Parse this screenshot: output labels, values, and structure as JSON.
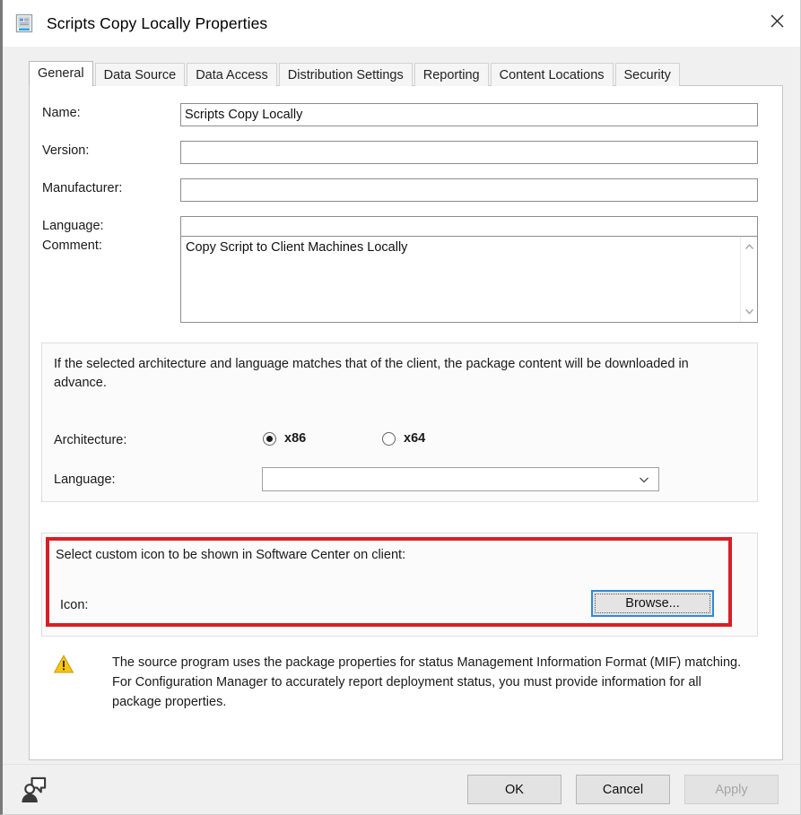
{
  "window": {
    "title": "Scripts Copy Locally Properties",
    "title_icon": "properties-document-icon",
    "close_label": "✕"
  },
  "tabs": [
    {
      "label": "General",
      "active": true
    },
    {
      "label": "Data Source",
      "active": false
    },
    {
      "label": "Data Access",
      "active": false
    },
    {
      "label": "Distribution Settings",
      "active": false
    },
    {
      "label": "Reporting",
      "active": false
    },
    {
      "label": "Content Locations",
      "active": false
    },
    {
      "label": "Security",
      "active": false
    }
  ],
  "general": {
    "fields": [
      {
        "label": "Name:",
        "value": "Scripts Copy Locally",
        "placeholder": ""
      },
      {
        "label": "Version:",
        "value": "",
        "placeholder": ""
      },
      {
        "label": "Manufacturer:",
        "value": "",
        "placeholder": ""
      },
      {
        "label": "Language:",
        "value": "",
        "placeholder": ""
      }
    ],
    "comment": {
      "label": "Comment:",
      "value": "Copy Script to Client Machines Locally",
      "placeholder": "",
      "scroll_up_icon": "chevron-up-icon",
      "scroll_down_icon": "chevron-down-icon"
    },
    "architecture_group": {
      "description": "If the selected architecture and language matches that of the client, the package content will be downloaded in advance.",
      "architecture_label": "Architecture:",
      "options": [
        {
          "label": "x86",
          "selected": true
        },
        {
          "label": "x64",
          "selected": false
        }
      ],
      "language_label": "Language:",
      "language_value": "",
      "language_chevron": "chevron-down-icon"
    },
    "icon_group": {
      "description": "Select custom icon to be shown in Software Center on client:",
      "icon_label": "Icon:",
      "browse_label": "Browse...",
      "highlight_color": "#d81f26",
      "focus_color": "#2f8ad8"
    },
    "warning": {
      "icon": "warning-triangle-icon",
      "icon_color": "#f5c518",
      "text": "The source program uses the package properties for status Management Information Format (MIF) matching. For Configuration Manager to accurately report deployment status, you must provide information for all package properties."
    }
  },
  "footer": {
    "feedback_icon": "person-feedback-icon",
    "ok_label": "OK",
    "cancel_label": "Cancel",
    "apply_label": "Apply",
    "apply_disabled": true
  }
}
